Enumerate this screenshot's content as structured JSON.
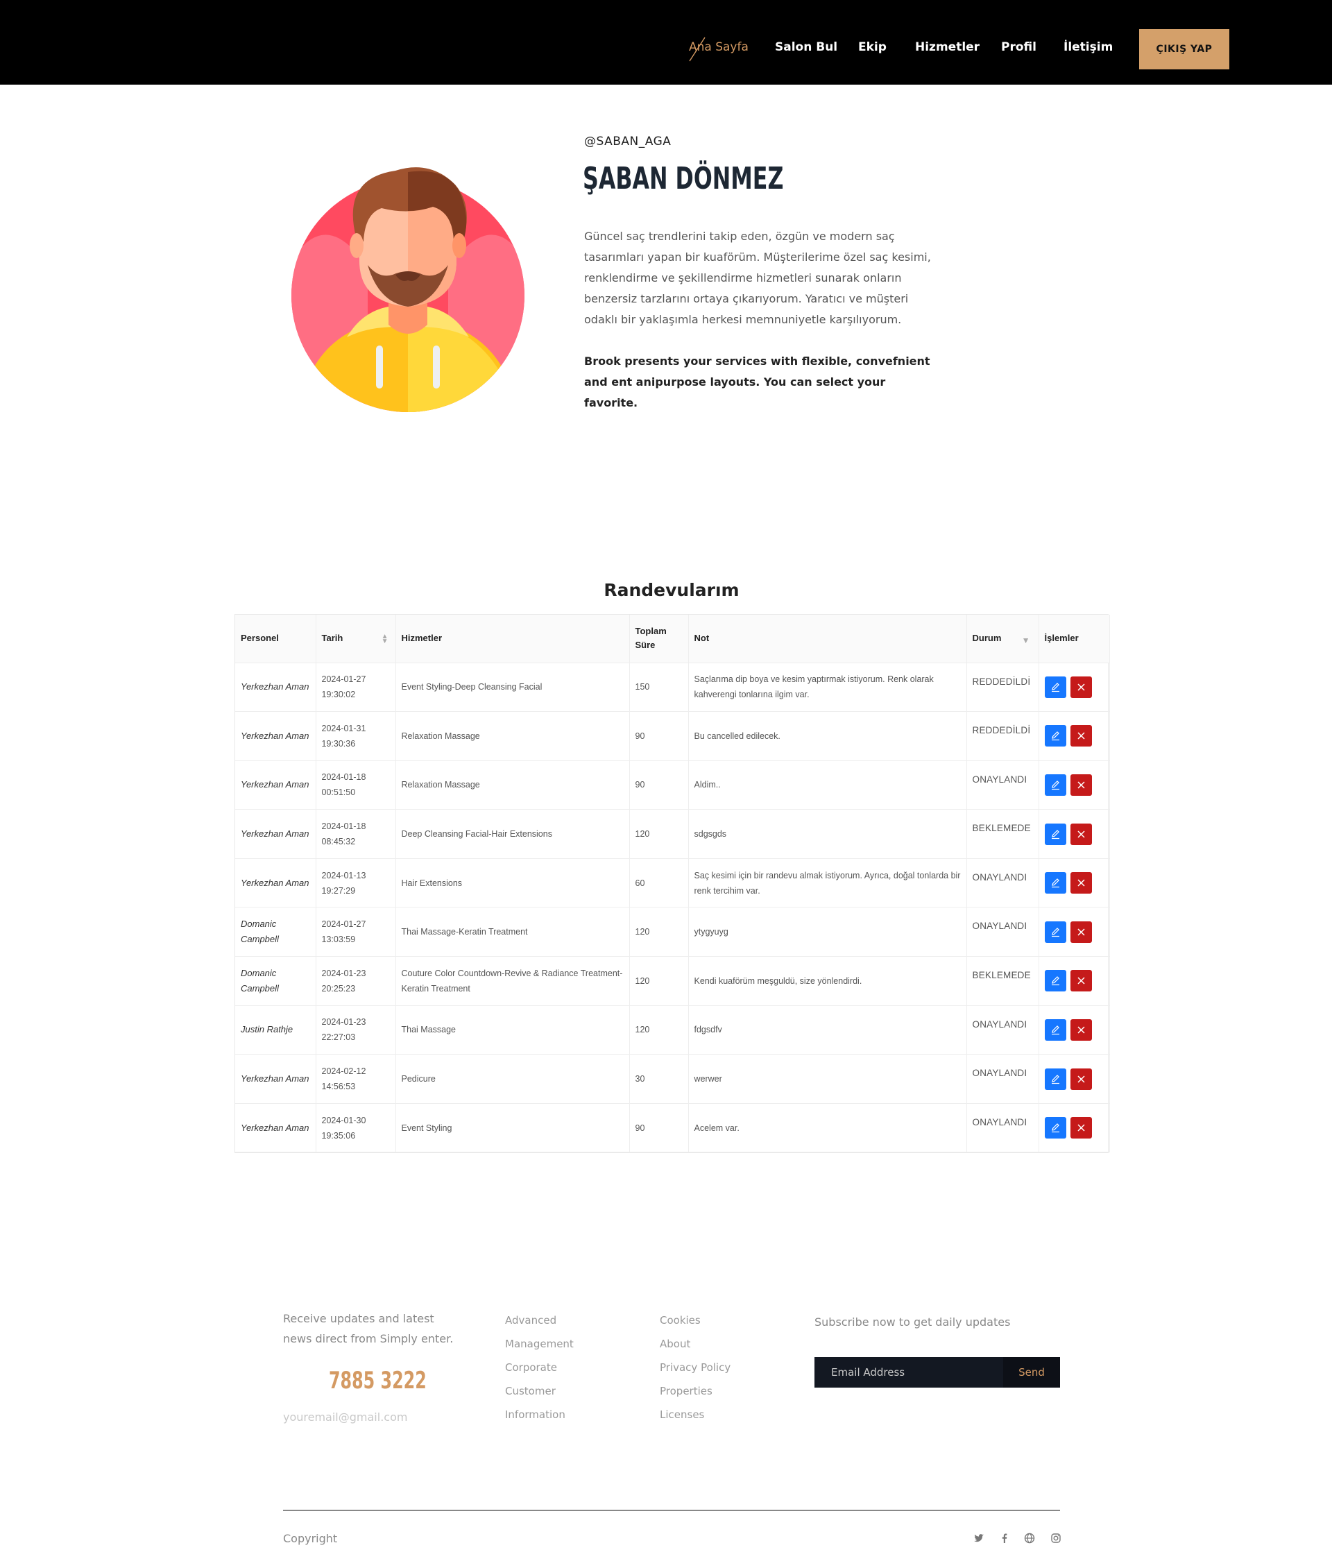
{
  "nav": {
    "items": [
      "Ana Sayfa",
      "Salon Bul",
      "Ekip",
      "Hizmetler",
      "Profil",
      "İletişim"
    ],
    "logout_label": "ÇIKIŞ YAP",
    "accent": "#d49a63"
  },
  "profile": {
    "handle": "@SABAN_AGA",
    "name": "ŞABAN DÖNMEZ",
    "bio": "Güncel saç trendlerini takip eden, özgün ve modern saç tasarımları yapan bir kuaförüm. Müşterilerime özel saç kesimi, renklendirme ve şekillendirme hizmetleri sunarak onların benzersiz tarzlarını ortaya çıkarıyorum. Yaratıcı ve müşteri odaklı bir yaklaşımla herkesi memnuniyetle karşılıyorum.",
    "tagline": "Brook presents your services with flexible, convefnient and ent anipurpose layouts. You can select your favorite."
  },
  "appointments": {
    "title": "Randevularım",
    "columns": [
      "Personel",
      "Tarih",
      "Hizmetler",
      "Toplam Süre",
      "Not",
      "Durum",
      "İşlemler"
    ],
    "rows": [
      {
        "personel": "Yerkezhan Aman",
        "tarih": "2024-01-27 19:30:02",
        "hizmetler": "Event Styling-Deep Cleansing Facial",
        "sure": "150",
        "not": "Saçlarıma dip boya ve kesim yaptırmak istiyorum. Renk olarak kahverengi tonlarına ilgim var.",
        "durum": "REDDEDİLDİ"
      },
      {
        "personel": "Yerkezhan Aman",
        "tarih": "2024-01-31 19:30:36",
        "hizmetler": "Relaxation Massage",
        "sure": "90",
        "not": "Bu cancelled edilecek.",
        "durum": "REDDEDİLDİ"
      },
      {
        "personel": "Yerkezhan Aman",
        "tarih": "2024-01-18 00:51:50",
        "hizmetler": "Relaxation Massage",
        "sure": "90",
        "not": "Aldim..",
        "durum": "ONAYLANDI"
      },
      {
        "personel": "Yerkezhan Aman",
        "tarih": "2024-01-18 08:45:32",
        "hizmetler": "Deep Cleansing Facial-Hair Extensions",
        "sure": "120",
        "not": "sdgsgds",
        "durum": "BEKLEMEDE"
      },
      {
        "personel": "Yerkezhan Aman",
        "tarih": "2024-01-13 19:27:29",
        "hizmetler": "Hair Extensions",
        "sure": "60",
        "not": "Saç kesimi için bir randevu almak istiyorum. Ayrıca, doğal tonlarda bir renk tercihim var.",
        "durum": "ONAYLANDI"
      },
      {
        "personel": "Domanic Campbell",
        "tarih": "2024-01-27 13:03:59",
        "hizmetler": "Thai Massage-Keratin Treatment",
        "sure": "120",
        "not": "ytygyuyg",
        "durum": "ONAYLANDI"
      },
      {
        "personel": "Domanic Campbell",
        "tarih": "2024-01-23 20:25:23",
        "hizmetler": "Couture Color Countdown-Revive & Radiance Treatment-Keratin Treatment",
        "sure": "120",
        "not": "Kendi kuaförüm meşguldü, size yönlendirdi.",
        "durum": "BEKLEMEDE"
      },
      {
        "personel": "Justin Rathje",
        "tarih": "2024-01-23 22:27:03",
        "hizmetler": "Thai Massage",
        "sure": "120",
        "not": "fdgsdfv",
        "durum": "ONAYLANDI"
      },
      {
        "personel": "Yerkezhan Aman",
        "tarih": "2024-02-12 14:56:53",
        "hizmetler": "Pedicure",
        "sure": "30",
        "not": "werwer",
        "durum": "ONAYLANDI"
      },
      {
        "personel": "Yerkezhan Aman",
        "tarih": "2024-01-30 19:35:06",
        "hizmetler": "Event Styling",
        "sure": "90",
        "not": "Acelem var.",
        "durum": "ONAYLANDI"
      }
    ]
  },
  "footer": {
    "intro": "Receive updates and latest news direct from Simply enter.",
    "phone": "7885 3222",
    "email": "youremail@gmail.com",
    "col1": [
      "Advanced",
      "Management",
      "Corporate",
      "Customer",
      "Information"
    ],
    "col2": [
      "Cookies",
      "About",
      "Privacy Policy",
      "Properties",
      "Licenses"
    ],
    "subscribe_text": "Subscribe now to get daily updates",
    "email_placeholder": "Email Address",
    "send_label": "Send",
    "copyright": "Copyright",
    "social_icons": [
      "twitter-icon",
      "facebook-icon",
      "globe-icon",
      "instagram-icon"
    ]
  }
}
